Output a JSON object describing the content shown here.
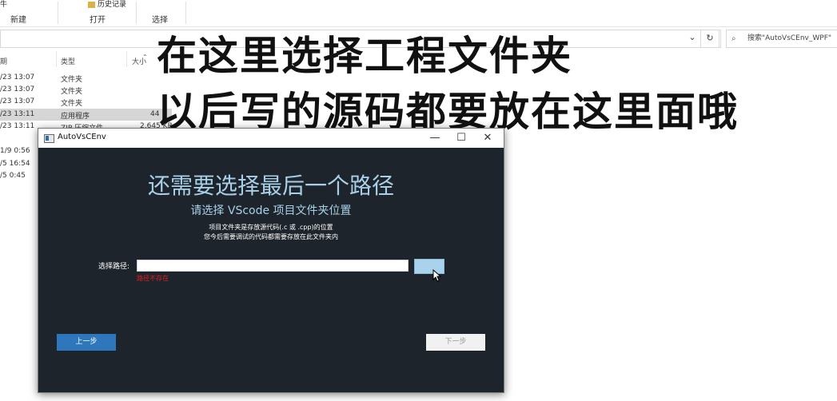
{
  "ribbon": {
    "item_partial": "牛",
    "history_label": "历史记录",
    "groups": [
      "新建",
      "打开",
      "选择"
    ]
  },
  "address": {
    "dropdown_icon": "⌄",
    "refresh_icon": "↻",
    "search_icon": "search-icon",
    "search_placeholder": "搜索\"AutoVsCEnv_WPF\""
  },
  "columns": [
    "期",
    "类型",
    "大小"
  ],
  "files": [
    {
      "date": "/23 13:07",
      "type": "文件夹",
      "size": ""
    },
    {
      "date": "/23 13:07",
      "type": "文件夹",
      "size": ""
    },
    {
      "date": "/23 13:07",
      "type": "文件夹",
      "size": ""
    },
    {
      "date": "/23 13:11",
      "type": "应用程序",
      "size": "44"
    },
    {
      "date": "/23 13:11",
      "type": "ZIP 压缩文件",
      "size": "2,645 KB"
    },
    {
      "date": "1/9 0:56",
      "type": "",
      "size": ""
    },
    {
      "date": "/5 16:54",
      "type": "",
      "size": ""
    },
    {
      "date": "/5 0:45",
      "type": "",
      "size": ""
    }
  ],
  "overlay": {
    "line1": "在这里选择工程文件夹",
    "line2": "以后写的源码都要放在这里面哦"
  },
  "window": {
    "title": "AutoVsCEnv",
    "minimize": "—",
    "maximize": "☐",
    "close": "✕",
    "heading": "还需要选择最后一个路径",
    "subheading": "请选择 VScode 项目文件夹位置",
    "desc1": "项目文件夹是存放源代码(.c 或 .cpp)的位置",
    "desc2": "您今后需要调试的代码都需要存放在此文件夹内",
    "path_label": "选择路径:",
    "path_value": "",
    "error": "路径不存在",
    "prev_label": "上一步",
    "next_label": "下一步"
  }
}
